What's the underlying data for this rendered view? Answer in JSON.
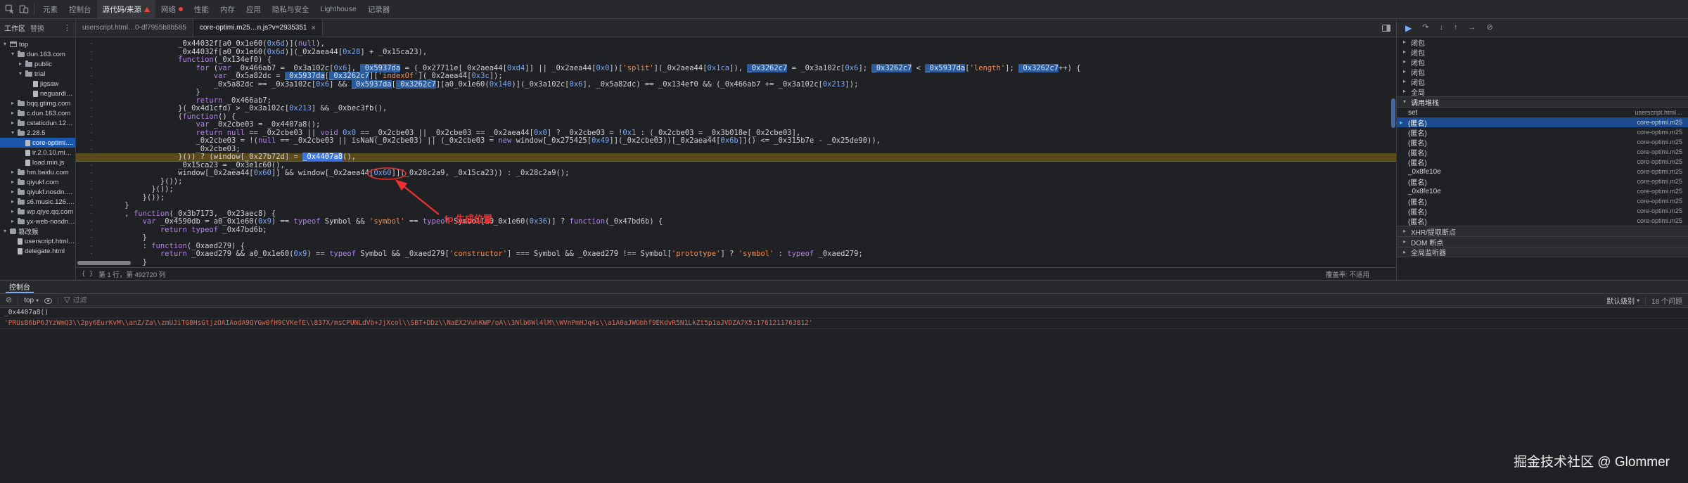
{
  "colors": {
    "accent_blue": "#7cacf8",
    "selection_blue": "#1b57ad",
    "paused_line_bg": "#5b4a1b",
    "annotation_red": "#f03030",
    "keyword": "#b083e6",
    "string": "#f28b54",
    "number": "#7ca6f2",
    "console_string": "#e06a56",
    "warning_red": "#e8433e"
  },
  "icons": {
    "chevron_down": "▾",
    "chevron_right": "▸",
    "overflow": "⋮",
    "close": "×",
    "clear_console": "⊘",
    "dropdown_caret": "▾",
    "filter_funnel": "▽",
    "braces": "{ }",
    "current_frame": "▸"
  },
  "main_tabs": {
    "items": [
      {
        "label": "元素"
      },
      {
        "label": "控制台"
      },
      {
        "label": "源代码/来源",
        "active": true,
        "badge": "warning"
      },
      {
        "label": "网络",
        "badge": "dot"
      },
      {
        "label": "性能"
      },
      {
        "label": "内存"
      },
      {
        "label": "应用"
      },
      {
        "label": "隐私与安全"
      },
      {
        "label": "Lighthouse"
      },
      {
        "label": "记录器"
      }
    ]
  },
  "sources_panel": {
    "nav_tabs": [
      "工作区",
      "替换"
    ],
    "file_tree": [
      {
        "label": "top",
        "indent": 0,
        "kind": "frame",
        "expanded": true
      },
      {
        "label": "dun.163.com",
        "indent": 1,
        "kind": "folder",
        "expanded": true
      },
      {
        "label": "public",
        "indent": 2,
        "kind": "folder",
        "expanded": false
      },
      {
        "label": "trial",
        "indent": 2,
        "kind": "folder",
        "expanded": true
      },
      {
        "label": "jigsaw",
        "indent": 3,
        "kind": "file"
      },
      {
        "label": "neguardian.umd.1…",
        "indent": 3,
        "kind": "file"
      },
      {
        "label": "bqq.gtimg.com",
        "indent": 1,
        "kind": "folder",
        "expanded": false
      },
      {
        "label": "c.dun.163.com",
        "indent": 1,
        "kind": "folder",
        "expanded": false
      },
      {
        "label": "cstaticdun.126.net",
        "indent": 1,
        "kind": "folder",
        "expanded": false
      },
      {
        "label": "2.28.5",
        "indent": 1,
        "kind": "folder",
        "expanded": true
      },
      {
        "label": "core-optimi.m2…",
        "indent": 2,
        "kind": "file",
        "selected": true
      },
      {
        "label": "ir.2.0.10.min.js?v=…",
        "indent": 2,
        "kind": "file"
      },
      {
        "label": "load.min.js",
        "indent": 2,
        "kind": "file"
      },
      {
        "label": "hm.baidu.com",
        "indent": 1,
        "kind": "folder",
        "expanded": false
      },
      {
        "label": "qiyukf.com",
        "indent": 1,
        "kind": "folder",
        "expanded": false
      },
      {
        "label": "qiyukf.nosdn.127.net",
        "indent": 1,
        "kind": "folder",
        "expanded": false
      },
      {
        "label": "s6.music.126.net",
        "indent": 1,
        "kind": "folder",
        "expanded": false
      },
      {
        "label": "wp.qiye.qq.com",
        "indent": 1,
        "kind": "folder",
        "expanded": false
      },
      {
        "label": "yx-web-nosdn.nete…",
        "indent": 1,
        "kind": "folder",
        "expanded": false
      },
      {
        "label": "篡改猴",
        "indent": 0,
        "kind": "ext",
        "expanded": true
      },
      {
        "label": "userscript.html?n…",
        "indent": 1,
        "kind": "file"
      },
      {
        "label": "delegate.html",
        "indent": 1,
        "kind": "file"
      }
    ]
  },
  "editor": {
    "tabs": [
      {
        "label": "userscript.html…0-df7955b8b585",
        "active": false
      },
      {
        "label": "core-optimi.m25…n.js?v=2935351",
        "active": true,
        "closable": true
      }
    ],
    "highlight_tokens": [
      "_0x5937da",
      "_0x3262c7"
    ],
    "code_lines": [
      {
        "t": "                _0x44032f[a0_0x1e60(0x6d)](null),"
      },
      {
        "t": "                _0x44032f[a0_0x1e60(0x6d)](_0x2aea44[0x28] + _0x15ca23),"
      },
      {
        "t": "                function(_0x134ef0) {"
      },
      {
        "t": "                    for (var _0x466ab7 = _0x3a102c[0x6], _0x5937da = (_0x27711e[_0x2aea44[0xd4]] || _0x2aea44[0x0])['split'](_0x2aea44[0x1ca]), _0x3262c7 = _0x3a102c[0x6]; _0x3262c7 < _0x5937da['length']; _0x3262c7++) {"
      },
      {
        "t": "                        var _0x5a82dc = _0x5937da[_0x3262c7]['indexOf'](_0x2aea44[0x3c]);"
      },
      {
        "t": "                        _0x5a82dc == _0x3a102c[0x6] && _0x5937da[_0x3262c7][a0_0x1e60(0x140)](_0x3a102c[0x6], _0x5a82dc) == _0x134ef0 && (_0x466ab7 += _0x3a102c[0x213]);"
      },
      {
        "t": "                    }"
      },
      {
        "t": "                    return _0x466ab7;"
      },
      {
        "t": "                }(_0x4d1cfd) > _0x3a102c[0x213] && _0xbec3fb(),"
      },
      {
        "t": "                (function() {"
      },
      {
        "t": "                    var _0x2cbe03 = _0x4407a8();"
      },
      {
        "t": "                    return null == _0x2cbe03 || void 0x0 == _0x2cbe03 || _0x2cbe03 == _0x2aea44[0x0] ? _0x2cbe03 = !0x1 : (_0x2cbe03 = _0x3b018e[_0x2cbe03],"
      },
      {
        "t": "                    _0x2cbe03 = !(null == _0x2cbe03 || isNaN(_0x2cbe03) || (_0x2cbe03 = new window[_0x275425[0x49]](_0x2cbe03))[_0x2aea44[0x6b]]() <= _0x315b7e - _0x25de90)),"
      },
      {
        "t": "                    _0x2cbe03;"
      },
      {
        "t": "                }()) ? (window[_0x27b72d] = _0x4407a8(),",
        "p": true,
        "caret": "_0x4407a8"
      },
      {
        "t": "                _0x15ca23 = _0x3e1c60(),"
      },
      {
        "t": "                window[_0x2aea44[0x60]] && window[_0x2aea44[0x60]](_0x28c2a9, _0x15ca23)) : _0x28c2a9();"
      },
      {
        "t": "            }());"
      },
      {
        "t": "          }());"
      },
      {
        "t": "        }());"
      },
      {
        "t": "    }"
      },
      {
        "t": "    , function(_0x3b7173, _0x23aec8) {"
      },
      {
        "t": "        var _0x4590db = a0_0x1e60(0x9) == typeof Symbol && 'symbol' == typeof Symbol[a0_0x1e60(0x36)] ? function(_0x47bd6b) {"
      },
      {
        "t": "            return typeof _0x47bd6b;"
      },
      {
        "t": "        }"
      },
      {
        "t": "        : function(_0xaed279) {"
      },
      {
        "t": "            return _0xaed279 && a0_0x1e60(0x9) == typeof Symbol && _0xaed279['constructor'] === Symbol && _0xaed279 !== Symbol['prototype'] ? 'symbol' : typeof _0xaed279;"
      },
      {
        "t": "        }"
      }
    ],
    "annotation": {
      "label": "fp 生成位置"
    },
    "status_bar": {
      "position": "第 1 行，第 492720 列",
      "coverage": "覆盖率: 不适用"
    }
  },
  "debugger": {
    "controls": [
      {
        "name": "resume",
        "glyph": "▶",
        "accent": true
      },
      {
        "name": "step-over",
        "glyph": "↷"
      },
      {
        "name": "step-into",
        "glyph": "↓"
      },
      {
        "name": "step-out",
        "glyph": "↑"
      },
      {
        "name": "step",
        "glyph": "→"
      },
      {
        "name": "deactivate-breakpoints",
        "glyph": "⊘"
      }
    ],
    "scope_rows": [
      "闭包",
      "闭包",
      "闭包",
      "闭包",
      "闭包",
      "全局"
    ],
    "call_stack": {
      "title": "调用堆栈",
      "frames": [
        {
          "name": "set",
          "file": "userscript.html…"
        },
        {
          "name": "(匿名)",
          "file": "core-optimi.m25",
          "selected": true
        },
        {
          "name": "(匿名)",
          "file": "core-optimi.m25"
        },
        {
          "name": "(匿名)",
          "file": "core-optimi.m25"
        },
        {
          "name": "(匿名)",
          "file": "core-optimi.m25"
        },
        {
          "name": "(匿名)",
          "file": "core-optimi.m25"
        },
        {
          "name": "_0x8fe10e",
          "file": "core-optimi.m25"
        },
        {
          "name": "(匿名)",
          "file": "core-optimi.m25"
        },
        {
          "name": "_0x8fe10e",
          "file": "core-optimi.m25"
        },
        {
          "name": "(匿名)",
          "file": "core-optimi.m25"
        },
        {
          "name": "(匿名)",
          "file": "core-optimi.m25"
        },
        {
          "name": "(匿名)",
          "file": "core-optimi.m25"
        }
      ]
    },
    "breakpoint_sections": [
      "XHR/提取断点",
      "DOM 断点",
      "全局监听器"
    ]
  },
  "console": {
    "tab_label": "控制台",
    "toolbar": {
      "context": "top",
      "filter_placeholder": "过滤",
      "level": "默认级别",
      "issues": "18 个问题"
    },
    "messages": [
      {
        "type": "input",
        "text": "_0x4407a8()"
      },
      {
        "type": "string",
        "text": "'PRUsB6bP6JYzWmQ3\\\\2py6EurKvM\\\\anZ/Za\\\\zmUJiTG8HsGtjzOAIAodA9QYGw0fH9CVKefE\\\\837X/msCPUNLdVb+JjXcol\\\\SBT+DDz\\\\NaEX2VuhKWP/oA\\\\3Nlb6Wl4lM\\\\WVnPmHJq4s\\\\a1A0aJWObhf9EKdvR5N1LkZt5p1aJVDZA7X5:1761211763812'"
      }
    ]
  },
  "watermark": "掘金技术社区 @ Glommer"
}
